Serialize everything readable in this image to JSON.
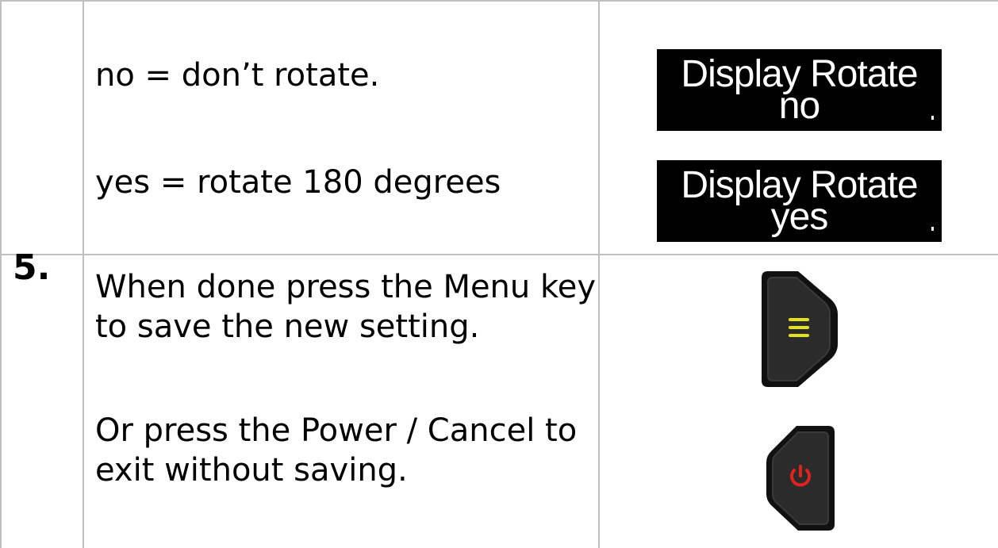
{
  "rows": [
    {
      "step": "",
      "paragraphs": [
        "no = don’t rotate.",
        "yes = rotate 180 degrees"
      ],
      "displays": [
        {
          "title": "Display Rotate",
          "value": "no"
        },
        {
          "title": "Display Rotate",
          "value": "yes"
        }
      ]
    },
    {
      "step": "5.",
      "paragraph1_lines": [
        "When done press the Menu key",
        "to save the new setting."
      ],
      "paragraph2_lines": [
        "Or press the Power / Cancel to",
        "exit without saving."
      ],
      "keys": [
        {
          "icon": "menu-icon",
          "accent": "#e3e11a"
        },
        {
          "icon": "power-icon",
          "accent": "#e0231c"
        }
      ]
    }
  ],
  "colors": {
    "border": "#bfbfbf",
    "display_bg": "#000000",
    "display_text": "#ffffff"
  }
}
